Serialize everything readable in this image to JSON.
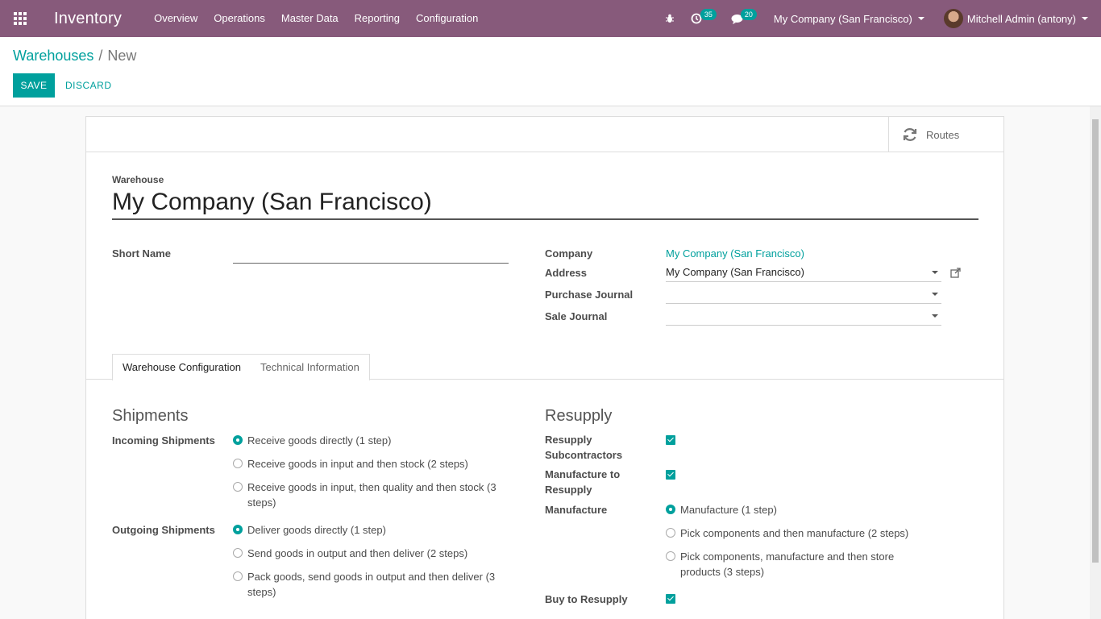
{
  "navbar": {
    "app_name": "Inventory",
    "menu": [
      "Overview",
      "Operations",
      "Master Data",
      "Reporting",
      "Configuration"
    ],
    "activity_badge": "35",
    "messages_badge": "20",
    "company": "My Company (San Francisco)",
    "user": "Mitchell Admin (antony)",
    "accent_color": "#875a7b"
  },
  "control_panel": {
    "breadcrumb_parent": "Warehouses",
    "breadcrumb_current": "New",
    "save_label": "SAVE",
    "discard_label": "DISCARD"
  },
  "sheet": {
    "routes_label": "Routes",
    "warehouse_label": "Warehouse",
    "warehouse_name": "My Company (San Francisco)",
    "short_name_label": "Short Name",
    "short_name_value": "",
    "company_label": "Company",
    "company_value": "My Company (San Francisco)",
    "address_label": "Address",
    "address_value": "My Company (San Francisco)",
    "purchase_journal_label": "Purchase Journal",
    "purchase_journal_value": "",
    "sale_journal_label": "Sale Journal",
    "sale_journal_value": ""
  },
  "tabs": {
    "config": "Warehouse Configuration",
    "technical": "Technical Information"
  },
  "shipments": {
    "title": "Shipments",
    "incoming_label": "Incoming Shipments",
    "incoming_options": [
      "Receive goods directly (1 step)",
      "Receive goods in input and then stock (2 steps)",
      "Receive goods in input, then quality and then stock (3 steps)"
    ],
    "outgoing_label": "Outgoing Shipments",
    "outgoing_options": [
      "Deliver goods directly (1 step)",
      "Send goods in output and then deliver (2 steps)",
      "Pack goods, send goods in output and then deliver (3 steps)"
    ]
  },
  "resupply": {
    "title": "Resupply",
    "resupply_subcontractors_label": "Resupply Subcontractors",
    "manufacture_to_resupply_label": "Manufacture to Resupply",
    "manufacture_label": "Manufacture",
    "manufacture_options": [
      "Manufacture (1 step)",
      "Pick components and then manufacture (2 steps)",
      "Pick components, manufacture and then store products (3 steps)"
    ],
    "buy_to_resupply_label": "Buy to Resupply"
  }
}
